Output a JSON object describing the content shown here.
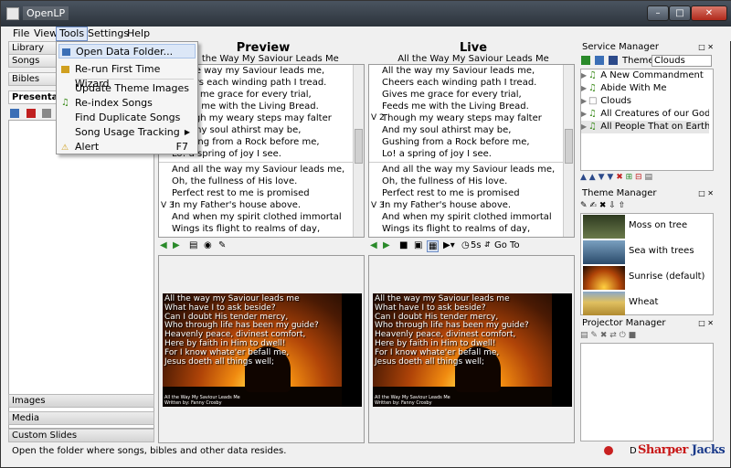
{
  "window": {
    "title": "OpenLP"
  },
  "menubar": {
    "file": "File",
    "view": "View",
    "tools": "Tools",
    "settings": "Settings",
    "help": "Help"
  },
  "tools_menu": {
    "items": [
      {
        "label": "Open Data Folder...",
        "icon": "folder-icon"
      },
      {
        "label": "Re-run First Time Wizard",
        "icon": "wizard-icon"
      },
      {
        "label": "Update Theme Images",
        "icon": ""
      },
      {
        "label": "Re-index Songs",
        "icon": "song-icon"
      },
      {
        "label": "Find Duplicate Songs",
        "icon": ""
      },
      {
        "label": "Song Usage Tracking",
        "icon": ""
      },
      {
        "label": "Alert",
        "icon": "alert-icon",
        "shortcut": "F7"
      }
    ]
  },
  "library": {
    "header": "Library",
    "tabs_top": [
      "Songs",
      "Bibles",
      "Presentations"
    ],
    "tabs_bottom": [
      "Images",
      "Media",
      "Custom Slides"
    ]
  },
  "preview": {
    "title": "Preview",
    "song_title": "All the Way My Saviour Leads Me",
    "verse1": [
      "All the way my Saviour leads me,",
      "Cheers each winding path I tread.",
      "Gives me grace for every trial,",
      "Feeds me with the Living Bread.",
      "Though my weary steps may falter",
      "And my soul athirst may be,",
      "Gushing from a Rock before me,",
      "Lo! a spring of joy I see."
    ],
    "verse1_label": "V 2",
    "verse2": [
      "And all the way my Saviour leads me,",
      "Oh, the fullness of His love.",
      "Perfect rest to me is promised",
      "In my Father's house above.",
      "And when my spirit clothed immortal",
      "Wings its flight to realms of day,"
    ],
    "verse2_label": "V 3"
  },
  "live": {
    "title": "Live",
    "song_title": "All the Way My Saviour Leads Me",
    "verse1": [
      "All the way my Saviour leads me,",
      "Cheers each winding path I tread.",
      "Gives me grace for every trial,",
      "Feeds me with the Living Bread.",
      "Though my weary steps may falter",
      "And my soul athirst may be,",
      "Gushing from a Rock before me,",
      "Lo! a spring of joy I see."
    ],
    "verse1_label": "V 2",
    "verse2": [
      "And all the way my Saviour leads me,",
      "Oh, the fullness of His love.",
      "Perfect rest to me is promised",
      "In my Father's house above.",
      "And when my spirit clothed immortal",
      "Wings its flight to realms of day,"
    ],
    "verse2_label": "V 3",
    "delay": "5s",
    "goto": "Go To"
  },
  "slide": {
    "lyrics": [
      "All the way my Saviour leads me",
      "What have I to ask beside?",
      "Can I doubt His tender mercy,",
      "Who through life has been my guide?",
      "Heavenly peace, divinest comfort,",
      "Here by faith in Him to dwell!",
      "For I know whate'er befall me,",
      "Jesus doeth all things well;"
    ],
    "footer_title": "All the Way My Saviour Leads Me",
    "footer_author": "Written by: Fanny Crosby"
  },
  "service_manager": {
    "header": "Service Manager",
    "theme_label": "Theme:",
    "theme_value": "Clouds",
    "items": [
      {
        "label": "A New Commandment",
        "type": "song"
      },
      {
        "label": "Abide With Me",
        "type": "song"
      },
      {
        "label": "Clouds",
        "type": "image"
      },
      {
        "label": "All Creatures of our God an...",
        "type": "song"
      },
      {
        "label": "All People That on Earth Do ...",
        "type": "song"
      }
    ]
  },
  "theme_manager": {
    "header": "Theme Manager",
    "themes": [
      {
        "name": "Moss on tree",
        "color": "#4d5a3a"
      },
      {
        "name": "Sea with trees",
        "color": "#3a6a8a"
      },
      {
        "name": "Sunrise (default)",
        "color": "#b8561a"
      },
      {
        "name": "Wheat",
        "color": "#c8a040"
      }
    ]
  },
  "projector_manager": {
    "header": "Projector Manager"
  },
  "statusbar": {
    "message": "Open the folder where songs, bibles and other data resides.",
    "right_text": "D"
  },
  "watermark": {
    "part1": "Sharper",
    "part2": "Jacks"
  },
  "colors": {
    "accent": "#dce7f7",
    "song_icon": "#3a8a1a",
    "watermark_red": "#c81818"
  }
}
